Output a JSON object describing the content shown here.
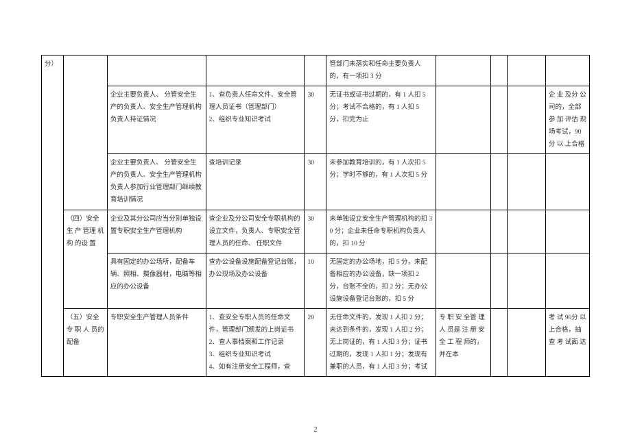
{
  "rows": [
    {
      "col1": "分）",
      "col2": "",
      "col3": "",
      "col4": "",
      "col5": "",
      "col6": "管部门未落实和任命主要负责人的，有一项扣 3 分",
      "col7": "",
      "col8": "",
      "col9": "",
      "col10": ""
    },
    {
      "col3": "企业主要负责人、 分管安全生产的负责人、安全生产管理机构负责人持证情况",
      "col4": "1、查负责人任命文件、安全管理人员证书（管理部门）\n2、组织专业知识考试",
      "col5": "30",
      "col6": "无证书或证书过期的，有 1 人扣 5 分；考试不合格的，有 1 人扣 5 分，扣完为止",
      "col10": "企 业 及分 公 司的，全部参 加 评估 现 场考试，90分 以 上合格"
    },
    {
      "col3": "企业主要负责人、 分管安全生产的负责人、安全生产管理机构负责人参加行业管理部门继续教育培训情况",
      "col4": "查培训记录",
      "col5": "30",
      "col6": "未参加教育培训的，有 1 人次扣 5 分；学时不够的，有 1 人次扣 5 分"
    },
    {
      "col2": "（四）安全 生 产 管理 机 构 的设 置",
      "col3": "企业及其分公司应当分别单独设置专职安全生产管理机构",
      "col4": "查企业及分公司安全专职机构的设立文件，负责人、专职安全管理人员的任命、 任职文件",
      "col5": "30",
      "col6": "未单独设立安全生产管理机构的扣 30 分；企业未任命专职机构负责人的，扣 10 分"
    },
    {
      "col3": "具有固定的办公场所，配备车辆、照相、摄像器材，电脑等相应的办公设备",
      "col4": "查办公设备设施配备登记台账，办公现场及办公设备",
      "col5": "10",
      "col6": "无固定的办公场地，扣 5 分，未配备相应的办公设备，缺一项扣 2 分，台账不全的，扣 2 分；无办公设施设备登记台账的，扣 5 分"
    },
    {
      "col2": "（五）安全专 职 人 员的配备",
      "col3": "专职安全生产管理人员条件",
      "col4": "1、查安全专职人员的任命文件，管理部门颁发的上岗证书\n2、查人事档案和工作记录\n3、组织专业知识考试\n4、如有注册安全工程师，查",
      "col5": "20",
      "col6": "无任命文件的，发现 1 人扣 2 分；未达到条件的，发现 1 人扣 2 分；无上岗证的，有 1 人扣 3 分；证书过期的，发现 1 人扣 1 分；发现有兼职的人员，有 1 人扣 3 分；考试",
      "col7": "专 职 安 全管 理 人 员是 注 册 安全 工 程 师的，并在本",
      "col10": "考 试 90分 以 上合格，抽查 考 试面 达"
    }
  ],
  "page_number": "2"
}
